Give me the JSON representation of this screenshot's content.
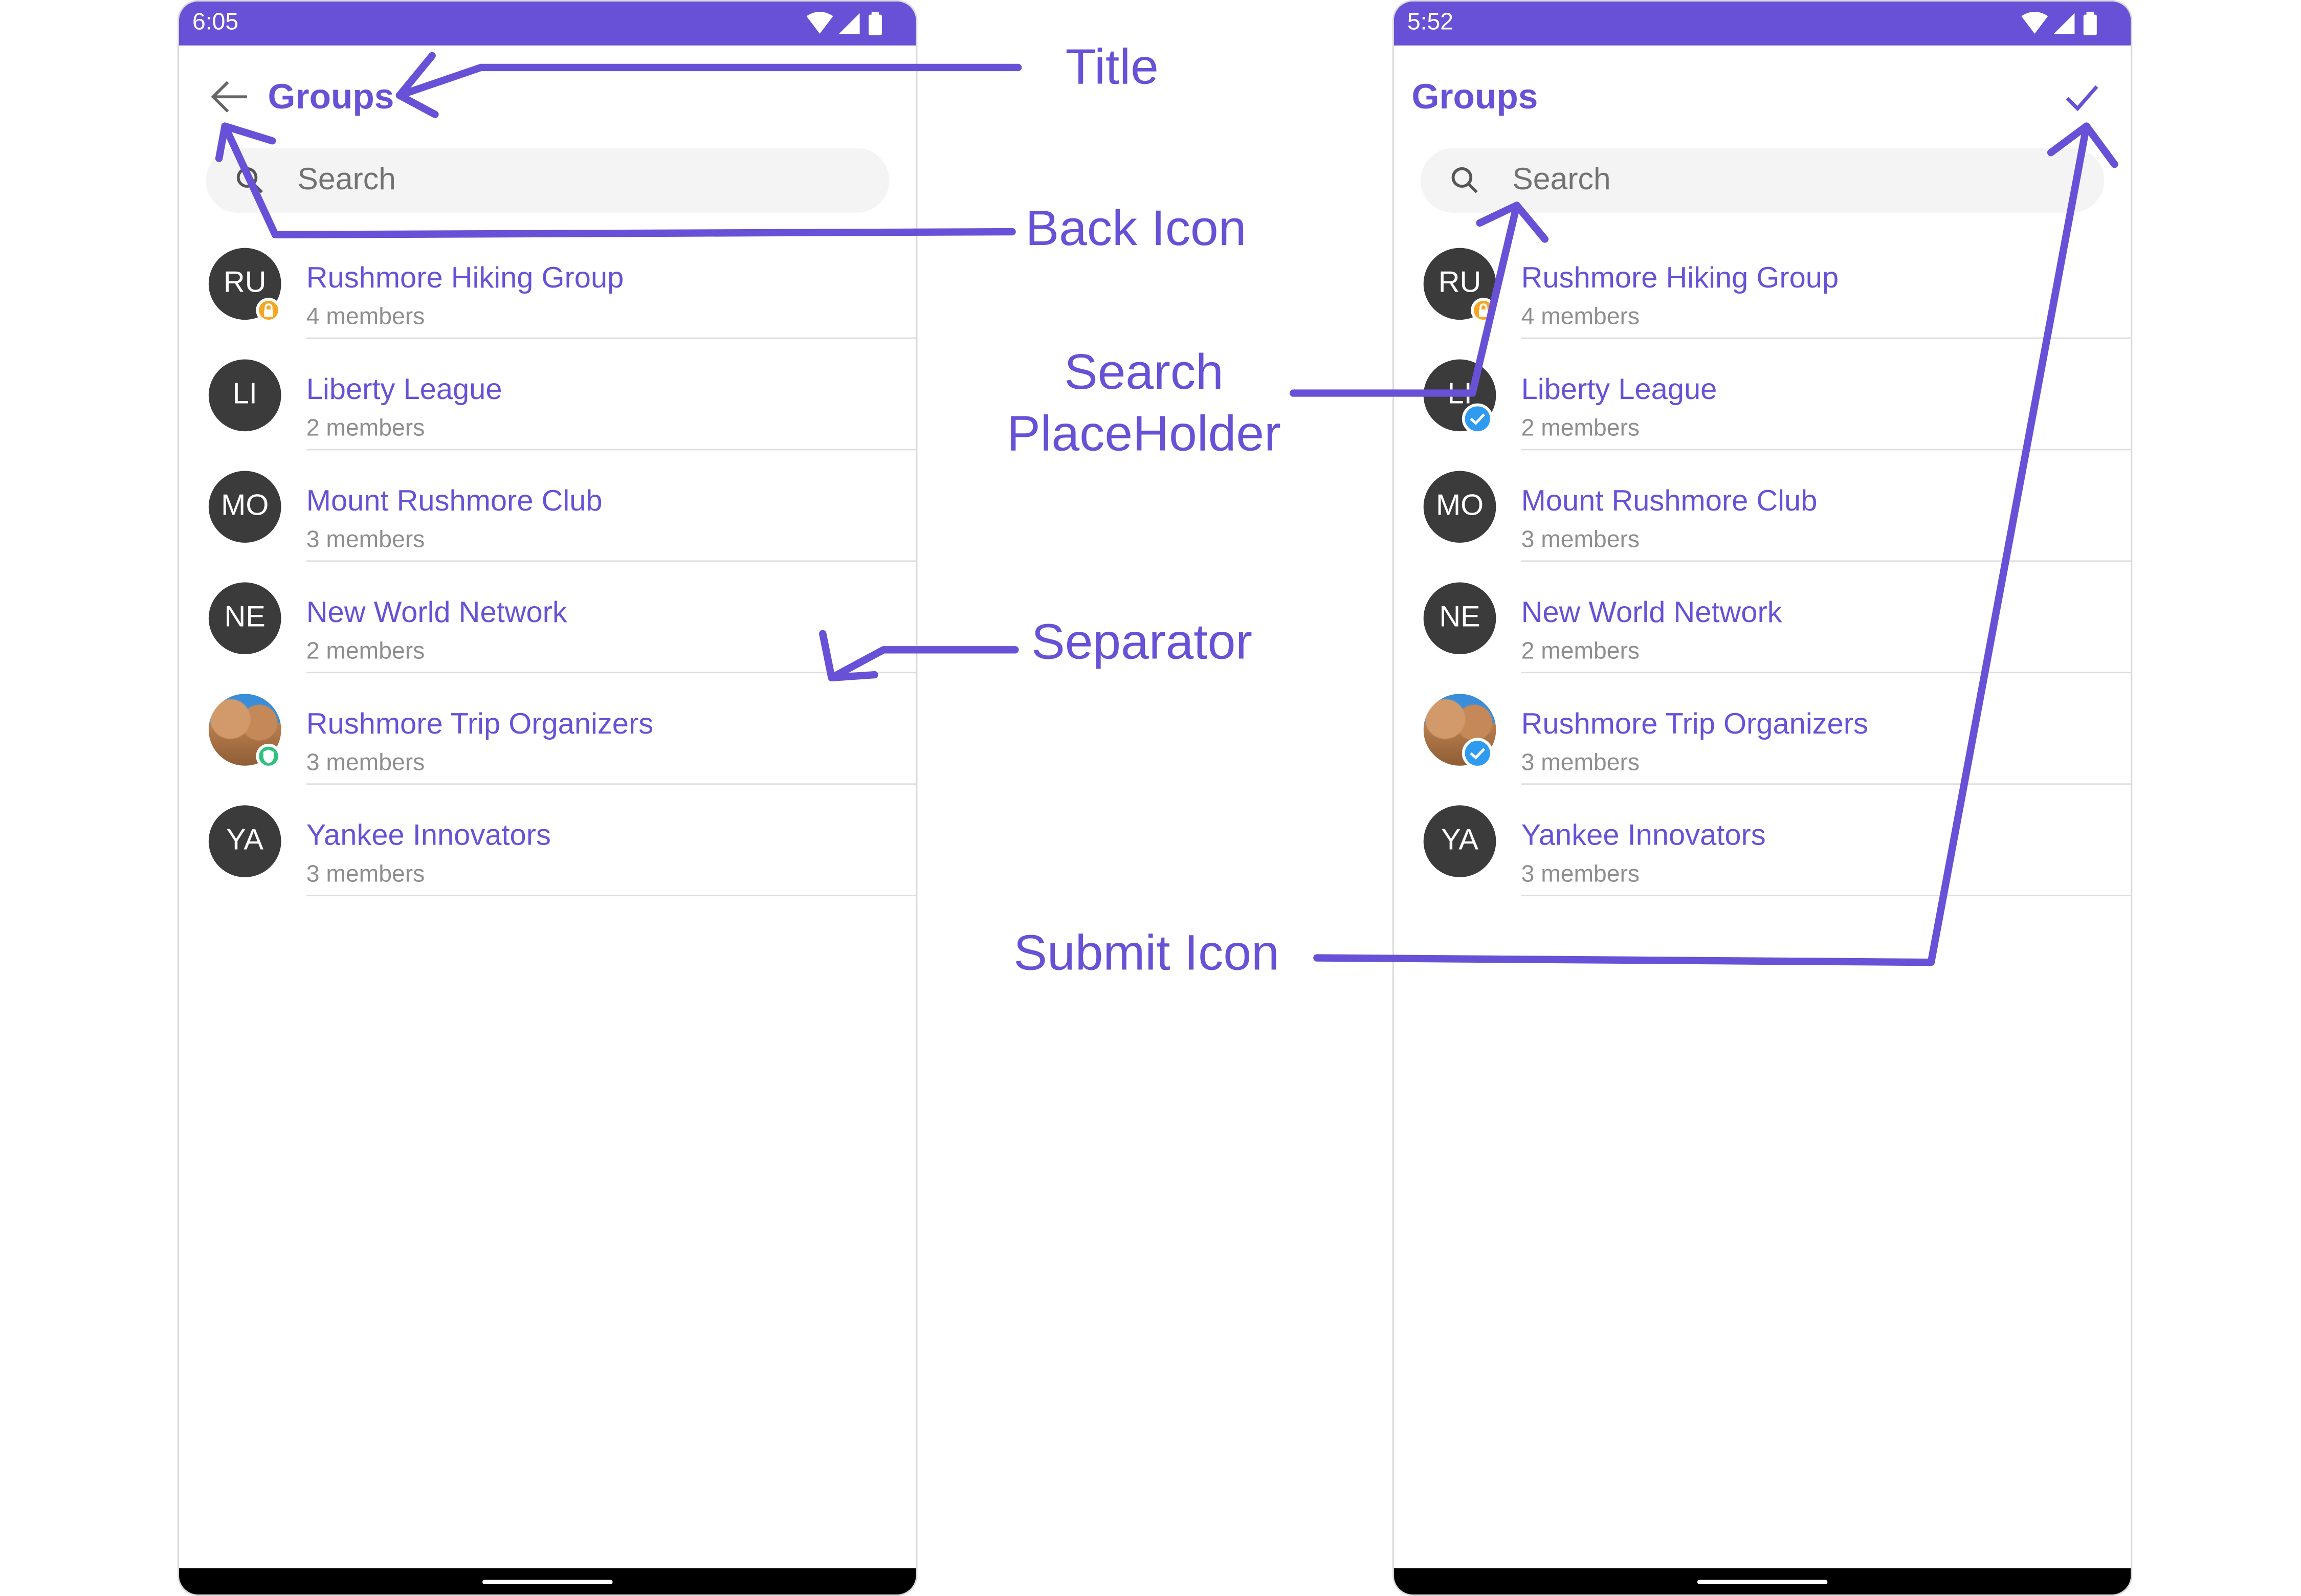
{
  "left_phone": {
    "status_time": "6:05",
    "title": "Groups",
    "search_placeholder": "Search",
    "groups": [
      {
        "initials": "RU",
        "name": "Rushmore Hiking Group",
        "members": "4 members",
        "badge": "lock"
      },
      {
        "initials": "LI",
        "name": "Liberty League",
        "members": "2 members",
        "badge": ""
      },
      {
        "initials": "MO",
        "name": "Mount Rushmore Club",
        "members": "3 members",
        "badge": ""
      },
      {
        "initials": "NE",
        "name": "New World Network",
        "members": "2 members",
        "badge": ""
      },
      {
        "initials": "",
        "name": "Rushmore Trip Organizers",
        "members": "3 members",
        "badge": "shield"
      },
      {
        "initials": "YA",
        "name": "Yankee Innovators",
        "members": "3 members",
        "badge": ""
      }
    ]
  },
  "right_phone": {
    "status_time": "5:52",
    "title": "Groups",
    "search_placeholder": "Search",
    "groups": [
      {
        "initials": "RU",
        "name": "Rushmore Hiking Group",
        "members": "4 members",
        "badge": "lock"
      },
      {
        "initials": "LI",
        "name": "Liberty League",
        "members": "2 members",
        "badge": "check"
      },
      {
        "initials": "MO",
        "name": "Mount Rushmore Club",
        "members": "3 members",
        "badge": ""
      },
      {
        "initials": "NE",
        "name": "New World Network",
        "members": "2 members",
        "badge": ""
      },
      {
        "initials": "",
        "name": "Rushmore Trip Organizers",
        "members": "3 members",
        "badge": "check"
      },
      {
        "initials": "YA",
        "name": "Yankee Innovators",
        "members": "3 members",
        "badge": ""
      }
    ]
  },
  "annotations": {
    "title": "Title",
    "back_icon": "Back Icon",
    "search_line1": "Search",
    "search_line2": "PlaceHolder",
    "separator": "Separator",
    "submit_icon": "Submit Icon"
  },
  "colors": {
    "accent": "#6851d6",
    "avatar": "#3b3b3b",
    "lock_badge": "#f5a623",
    "shield_badge": "#2ec27e",
    "check_badge": "#2f9bf0"
  }
}
